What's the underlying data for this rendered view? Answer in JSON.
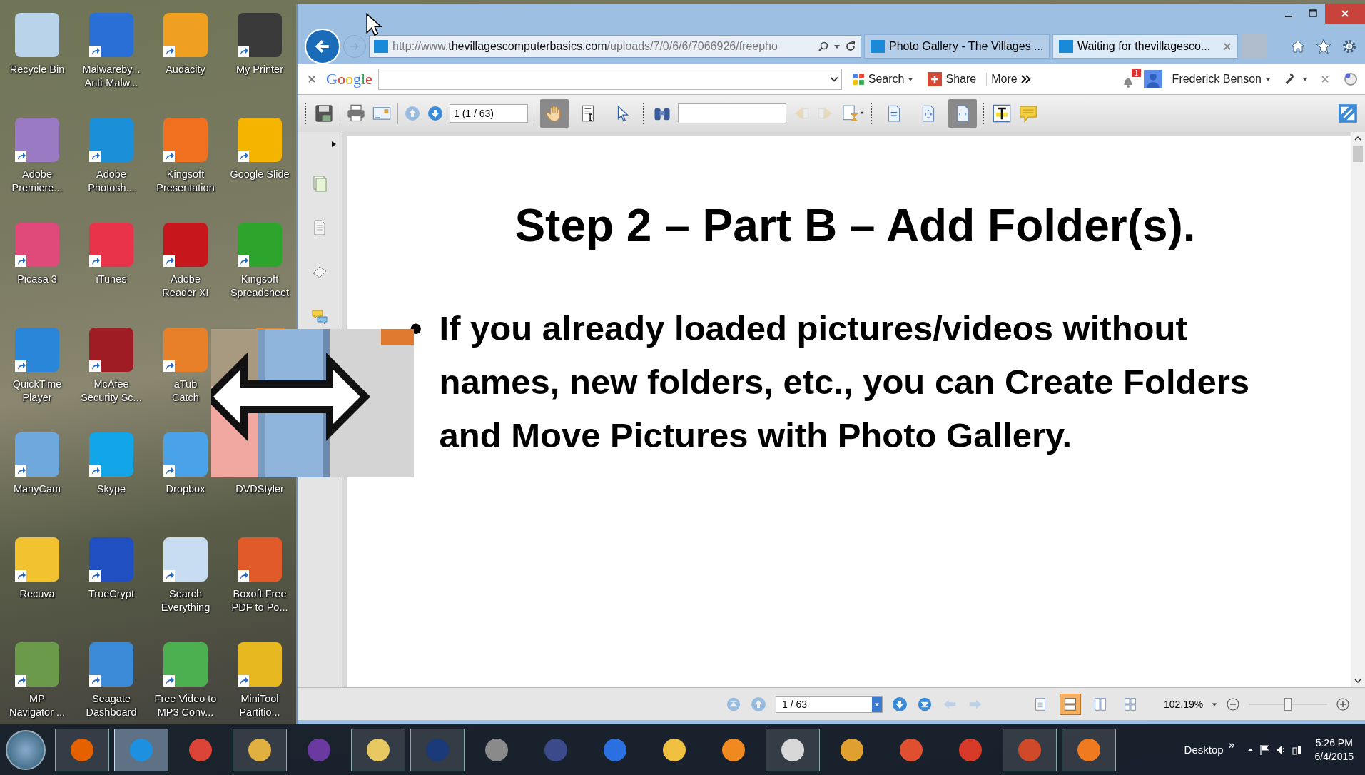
{
  "desktop_icons": [
    {
      "label": [
        "Recycle Bin"
      ],
      "color": "#b9d3ea",
      "shortcut": false
    },
    {
      "label": [
        "Malwareby...",
        "Anti-Malw..."
      ],
      "color": "#2a6fd6",
      "shortcut": true
    },
    {
      "label": [
        "Audacity"
      ],
      "color": "#f0a020",
      "shortcut": true
    },
    {
      "label": [
        "My Printer"
      ],
      "color": "#3a3a3a",
      "shortcut": true
    },
    {
      "label": [
        "Adobe",
        "Premiere..."
      ],
      "color": "#9b7ac4",
      "shortcut": true
    },
    {
      "label": [
        "Adobe",
        "Photosh..."
      ],
      "color": "#1b8fd8",
      "shortcut": true
    },
    {
      "label": [
        "Kingsoft",
        "Presentation"
      ],
      "color": "#f07020",
      "shortcut": true
    },
    {
      "label": [
        "Google Slide"
      ],
      "color": "#f4b400",
      "shortcut": true
    },
    {
      "label": [
        "Picasa 3"
      ],
      "color": "#e04a7a",
      "shortcut": true
    },
    {
      "label": [
        "iTunes"
      ],
      "color": "#e8334a",
      "shortcut": true
    },
    {
      "label": [
        "Adobe",
        "Reader XI"
      ],
      "color": "#c8161d",
      "shortcut": true
    },
    {
      "label": [
        "Kingsoft",
        "Spreadsheet"
      ],
      "color": "#2da52d",
      "shortcut": true
    },
    {
      "label": [
        "QuickTime",
        "Player"
      ],
      "color": "#2a86d8",
      "shortcut": true
    },
    {
      "label": [
        "McAfee",
        "Security Sc..."
      ],
      "color": "#a01c24",
      "shortcut": true
    },
    {
      "label": [
        "aTub",
        "Catch"
      ],
      "color": "#e8802a",
      "shortcut": true
    },
    {
      "color": "#e8862a"
    },
    {
      "label": [
        "ManyCam"
      ],
      "color": "#6fa8dc",
      "shortcut": true
    },
    {
      "label": [
        "Skype"
      ],
      "color": "#12a5e8",
      "shortcut": true
    },
    {
      "label": [
        "Dropbox"
      ],
      "color": "#4aa3e8",
      "shortcut": true
    },
    {
      "label": [
        "DVDStyler"
      ]
    },
    {
      "label": [
        "Recuva"
      ],
      "color": "#f2c230",
      "shortcut": true
    },
    {
      "label": [
        "TrueCrypt"
      ],
      "color": "#1f4fc0",
      "shortcut": true
    },
    {
      "label": [
        "Search",
        "Everything"
      ],
      "color": "#c8ddf2",
      "shortcut": true
    },
    {
      "label": [
        "Boxoft Free",
        "PDF to Po..."
      ],
      "color": "#e05a2a",
      "shortcut": true
    },
    {
      "label": [
        "MP",
        "Navigator ..."
      ],
      "color": "#6a9a4a",
      "shortcut": true
    },
    {
      "label": [
        "Seagate",
        "Dashboard"
      ],
      "color": "#3a8ad8",
      "shortcut": true
    },
    {
      "label": [
        "Free Video to",
        "MP3 Conv..."
      ],
      "color": "#4cb050",
      "shortcut": true
    },
    {
      "label": [
        "MiniTool",
        "Partitio..."
      ],
      "color": "#e8b820",
      "shortcut": true
    }
  ],
  "browser": {
    "tabs": [
      {
        "title": "Photo Gallery - The Villages ...",
        "selected": false
      },
      {
        "title": "Waiting for thevillagesco...",
        "selected": true
      }
    ],
    "address": {
      "scheme": "http://www.",
      "domain": "thevillagescomputerbasics.com",
      "path": "/uploads/7/0/6/6/7066926/freepho"
    },
    "google_bar": {
      "logo": "Google",
      "search": "Search",
      "share": "Share",
      "more": "More",
      "notifications": "1",
      "user": "Frederick Benson"
    },
    "pdf_toolbar": {
      "page_field": "1 (1 / 63)",
      "tools": [
        {
          "kind": "hand",
          "selected": true
        },
        {
          "kind": "select-text",
          "selected": false
        },
        {
          "kind": "pointer",
          "selected": false
        }
      ],
      "fit_modes": [
        {
          "kind": "actual-size",
          "selected": false
        },
        {
          "kind": "fit-page",
          "selected": false
        },
        {
          "kind": "fit-width",
          "selected": true
        }
      ]
    },
    "document": {
      "title": "Step 2 – Part B – Add Folder(s).",
      "bullets": [
        {
          "marker": "•",
          "text": "If you already loaded pictures/videos without names, new folders, etc., you can Create Folders and Move Pictures with Photo Gallery."
        }
      ]
    },
    "status_bar": {
      "page_field": "1 / 63",
      "zoom": "102.19%",
      "zoom_slider": {
        "level": 0.5
      },
      "view_modes": [
        {
          "kind": "single",
          "selected": false
        },
        {
          "kind": "continuous",
          "selected": true
        },
        {
          "kind": "facing",
          "selected": false
        },
        {
          "kind": "thumbnails",
          "selected": false
        }
      ]
    }
  },
  "taskbar": {
    "apps": [
      {
        "color": "#e66000",
        "running": true,
        "selected": false
      },
      {
        "color": "#1e90e0",
        "running": true,
        "selected": true
      },
      {
        "color": "#db4437",
        "running": false,
        "selected": false
      },
      {
        "color": "#e0b040",
        "running": true,
        "selected": false
      },
      {
        "color": "#6a3aa0",
        "running": false,
        "selected": false
      },
      {
        "color": "#e8c860",
        "running": true,
        "selected": false
      },
      {
        "color": "#1a3a7a",
        "running": true,
        "selected": false
      },
      {
        "color": "#8a8a8a",
        "running": false,
        "selected": false
      },
      {
        "color": "#3a4a8a",
        "running": false,
        "selected": false
      },
      {
        "color": "#2a70e0",
        "running": false,
        "selected": false
      },
      {
        "color": "#f0c040",
        "running": false,
        "selected": false
      },
      {
        "color": "#f08a20",
        "running": false,
        "selected": false
      },
      {
        "color": "#d8d8d8",
        "running": true,
        "selected": false
      },
      {
        "color": "#e0a030",
        "running": false,
        "selected": false
      },
      {
        "color": "#e05030",
        "running": false,
        "selected": false
      },
      {
        "color": "#d83a2a",
        "running": false,
        "selected": false
      },
      {
        "color": "#d04a2a",
        "running": true,
        "selected": false
      },
      {
        "color": "#f07a20",
        "running": true,
        "selected": false
      }
    ],
    "desktop_label": "Desktop",
    "overflow": "»",
    "time": "5:26 PM",
    "date": "6/4/2015"
  }
}
